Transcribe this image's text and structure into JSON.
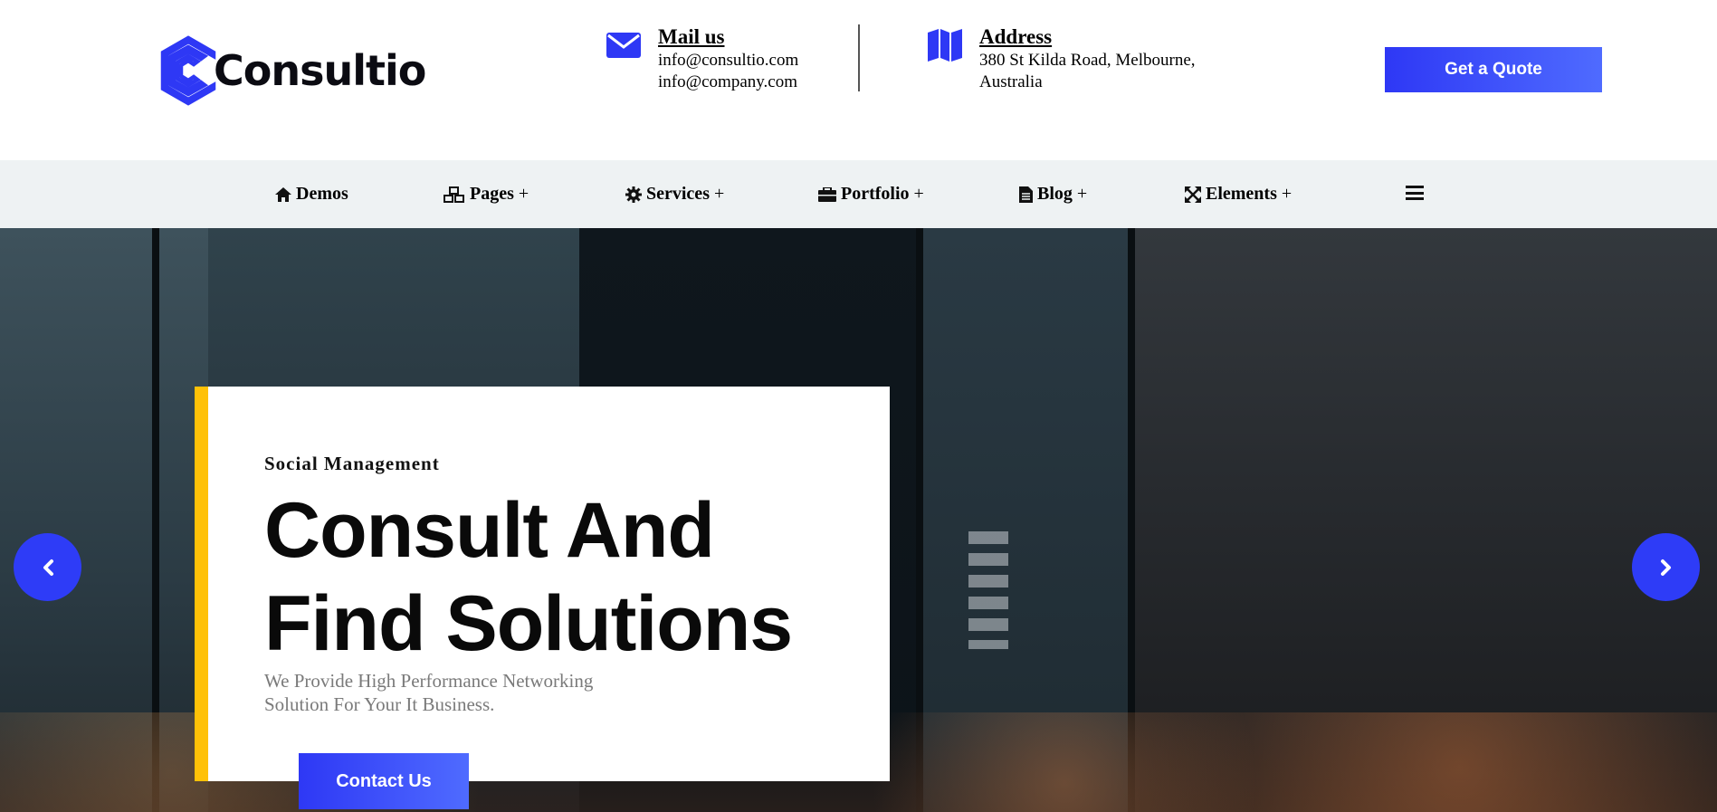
{
  "brand": {
    "name": "Consultio",
    "accent_color": "#2e38f5",
    "highlight_color": "#ffc107"
  },
  "contact": {
    "mail": {
      "icon": "envelope-icon",
      "title": "Mail us",
      "lines": [
        "info@consultio.com",
        "info@company.com"
      ]
    },
    "address": {
      "icon": "map-icon",
      "title": "Address",
      "lines": [
        "380 St Kilda Road, Melbourne,",
        "Australia"
      ]
    }
  },
  "header": {
    "quote_label": "Get a Quote"
  },
  "nav": {
    "items": [
      {
        "icon": "home-icon",
        "label": "Demos",
        "has_submenu": false
      },
      {
        "icon": "cubes-icon",
        "label": "Pages",
        "has_submenu": true
      },
      {
        "icon": "gear-icon",
        "label": "Services",
        "has_submenu": true
      },
      {
        "icon": "briefcase-icon",
        "label": "Portfolio",
        "has_submenu": true
      },
      {
        "icon": "file-icon",
        "label": "Blog",
        "has_submenu": true
      },
      {
        "icon": "expand-icon",
        "label": "Elements",
        "has_submenu": true
      }
    ],
    "submenu_marker": "+",
    "menu_icon": "hamburger-icon"
  },
  "hero": {
    "eyebrow": "Social Management",
    "title_lines": [
      "Consult And",
      "Find Solutions"
    ],
    "description": "We Provide High Performance Networking Solution For Your It Business.",
    "cta_label": "Contact Us",
    "prev_icon": "chevron-left-icon",
    "next_icon": "chevron-right-icon"
  }
}
